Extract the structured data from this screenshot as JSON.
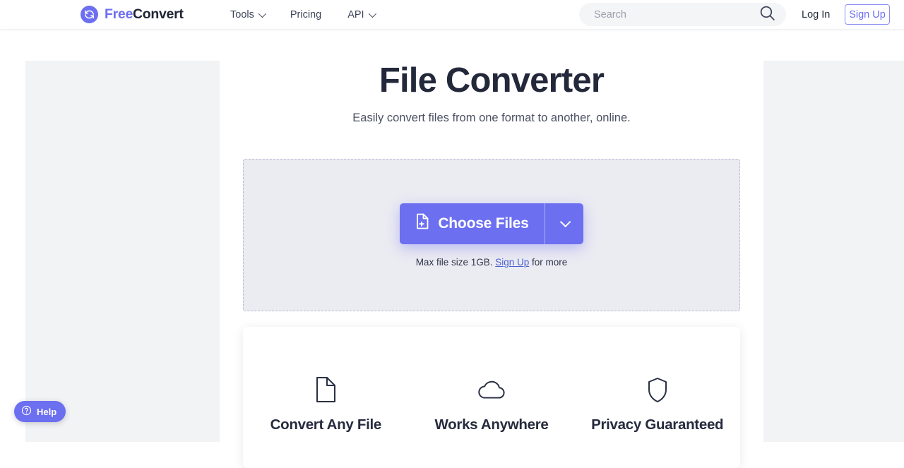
{
  "header": {
    "brand": {
      "part1": "Free",
      "part2": "Convert",
      "logo_icon": "refresh-circle-icon",
      "accent": "#6c6ff0"
    },
    "nav": [
      {
        "label": "Tools",
        "has_dropdown": true
      },
      {
        "label": "Pricing",
        "has_dropdown": false
      },
      {
        "label": "API",
        "has_dropdown": true
      }
    ],
    "search": {
      "placeholder": "Search",
      "value": "",
      "icon": "search-icon"
    },
    "login_label": "Log In",
    "signup_label": "Sign Up"
  },
  "main": {
    "title": "File Converter",
    "subtitle": "Easily convert files from one format to another, online.",
    "dropzone": {
      "choose_files_label": "Choose Files",
      "choose_files_icon": "file-plus-icon",
      "dropdown_icon": "chevron-down-icon",
      "note_prefix": "Max file size 1GB.",
      "note_link": "Sign Up",
      "note_suffix": "for more"
    },
    "features": [
      {
        "icon": "document-icon",
        "title": "Convert Any File"
      },
      {
        "icon": "cloud-icon",
        "title": "Works Anywhere"
      },
      {
        "icon": "shield-icon",
        "title": "Privacy Guaranteed"
      }
    ]
  },
  "help_widget": {
    "label": "Help",
    "icon": "question-circle-icon"
  },
  "colors": {
    "brand_purple": "#6c6ff0",
    "heading_dark": "#23283a",
    "dropzone_fill": "#ebebf2",
    "dropzone_border": "#b9bad4",
    "ad_placeholder": "#f2f3f4"
  }
}
